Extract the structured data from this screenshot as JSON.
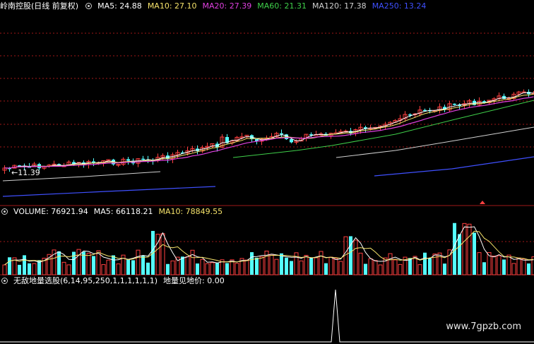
{
  "main_header": {
    "title": "岭南控股(日线 前复权)",
    "indicators": [
      {
        "label": "MA5: 24.88",
        "color": "#ffffff"
      },
      {
        "label": "MA10: 27.10",
        "color": "#f5e26a"
      },
      {
        "label": "MA20: 27.39",
        "color": "#e040e0"
      },
      {
        "label": "MA60: 21.31",
        "color": "#3fd04a"
      },
      {
        "label": "MA120: 17.38",
        "color": "#d0d0d0"
      },
      {
        "label": "MA250: 13.24",
        "color": "#3f50ff"
      }
    ]
  },
  "low_price_label": "11.39",
  "volume_header": {
    "title": "VOLUME: 76921.94",
    "indicators": [
      {
        "label": "MA5: 66118.21",
        "color": "#ffffff"
      },
      {
        "label": "MA10: 78849.55",
        "color": "#f5e26a"
      }
    ]
  },
  "custom_header": {
    "title": "无敌地量选股(6,14,95,250,1,1,1,1,1,1)",
    "value": "地量见地价: 0.00"
  },
  "watermark": "www.7gpzb.com",
  "colors": {
    "up": "#ff4040",
    "down": "#54ffff",
    "separator": "#a01818",
    "ma5": "#ffffff",
    "ma10": "#f5e26a",
    "ma20": "#e040e0",
    "ma60": "#3fd04a",
    "ma120": "#d0d0d0",
    "ma250": "#3f50ff"
  }
}
